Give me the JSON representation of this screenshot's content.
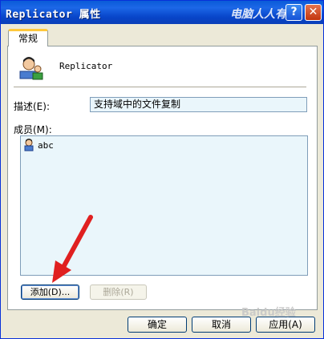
{
  "window": {
    "title": "Replicator 属性",
    "help_glyph": "?",
    "close_glyph": "✕",
    "watermark_top": "电脑人人有"
  },
  "tabs": [
    {
      "label": "常规",
      "active": true
    }
  ],
  "group": {
    "name": "Replicator",
    "icon": "group-users-icon",
    "description_label": "描述(E):",
    "description_value": "支持域中的文件复制",
    "members_label": "成员(M):",
    "members": [
      {
        "name": "abc",
        "icon": "user-icon"
      }
    ]
  },
  "actions": {
    "add_label": "添加(D)...",
    "remove_label": "删除(R)"
  },
  "footer": {
    "ok_label": "确定",
    "cancel_label": "取消",
    "apply_label": "应用(A)"
  },
  "watermark_bottom": "Baidu经验",
  "colors": {
    "titlebar": "#0a5bd8",
    "dialog_bg": "#ece9d8",
    "input_bg": "#eaf6fb",
    "arrow": "#e02020",
    "tab_accent": "#ffc83c"
  }
}
